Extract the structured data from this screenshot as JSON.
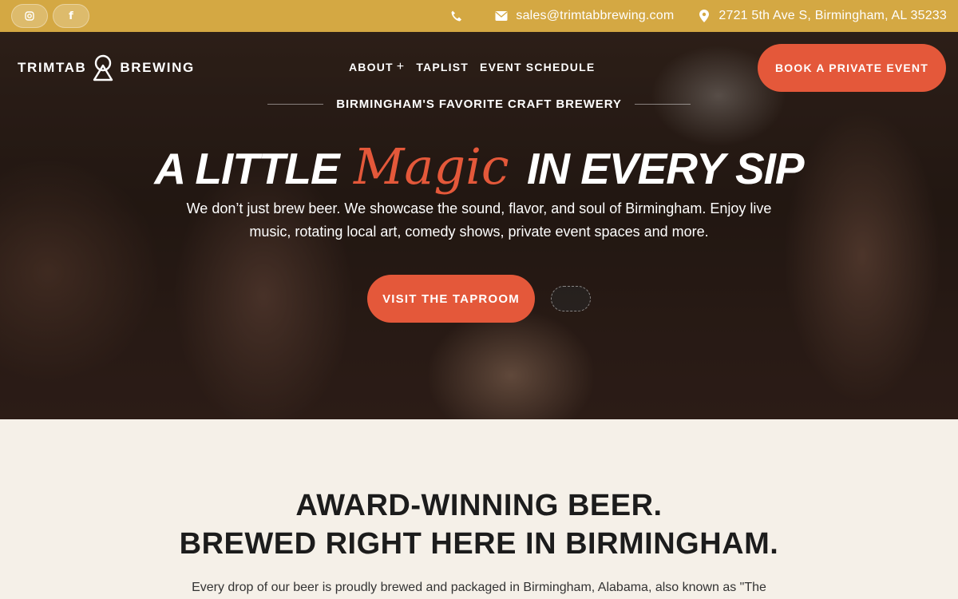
{
  "colors": {
    "topbar": "#d4a843",
    "accent": "#e4583a",
    "cream": "#f5f0e8"
  },
  "topbar": {
    "social": [
      {
        "icon": "instagram-icon",
        "glyph": "◎"
      },
      {
        "icon": "facebook-icon",
        "glyph": "f"
      }
    ],
    "phone_icon": "phone-icon",
    "email": "sales@trimtabbrewing.com",
    "address": "2721 5th Ave S, Birmingham, AL 35233"
  },
  "header": {
    "logo_left": "TRIMTAB",
    "logo_right": "BREWING",
    "nav": [
      {
        "label": "ABOUT",
        "has_submenu": true
      },
      {
        "label": "TAPLIST"
      },
      {
        "label": "EVENT SCHEDULE"
      }
    ],
    "cta": "BOOK A PRIVATE EVENT"
  },
  "hero": {
    "eyebrow": "BIRMINGHAM'S FAVORITE CRAFT BREWERY",
    "headline_pre": "A LITTLE",
    "headline_magic": "Magic",
    "headline_post": "IN EVERY SIP",
    "subtitle": "We don’t just brew beer. We showcase the sound, flavor, and soul of Birmingham. Enjoy live music, rotating local art, comedy shows, private event spaces and more.",
    "button": "VISIT THE TAPROOM"
  },
  "section": {
    "heading_line1": "AWARD-WINNING BEER.",
    "heading_line2": "BREWED RIGHT HERE IN BIRMINGHAM.",
    "paragraph": "Every drop of our beer is proudly brewed and packaged in Birmingham, Alabama, also known as \"The"
  }
}
